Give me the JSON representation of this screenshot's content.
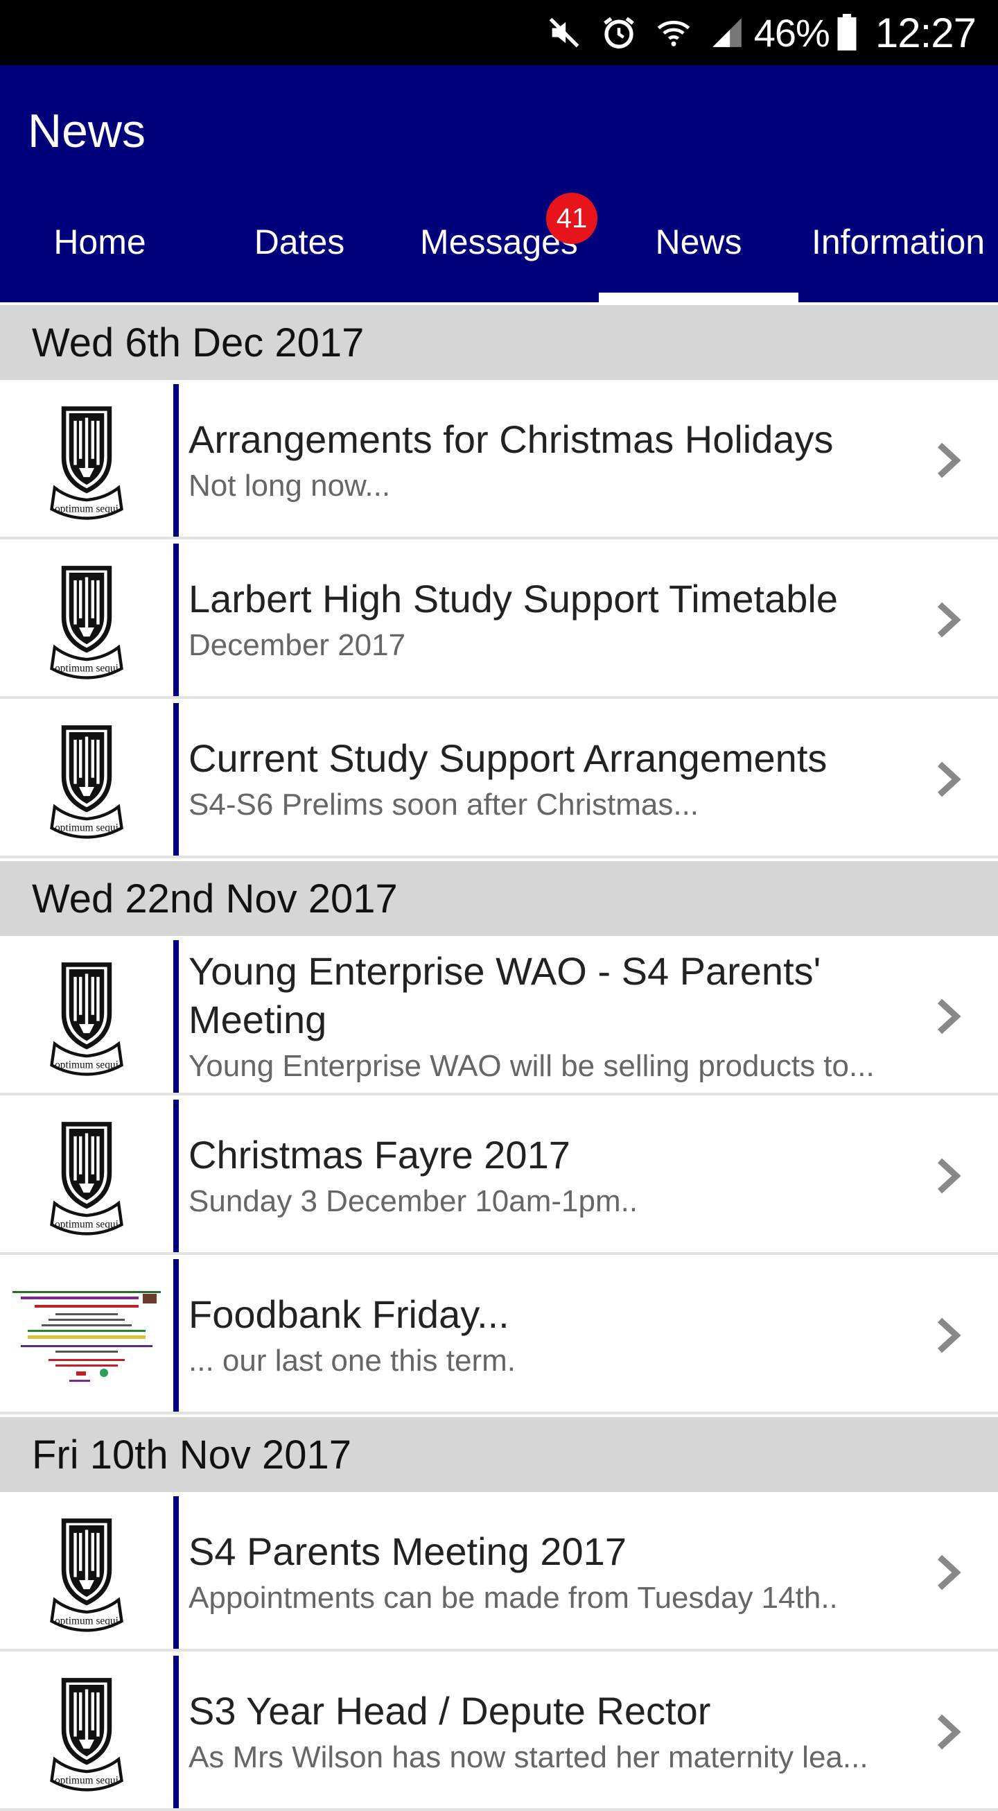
{
  "status_bar": {
    "battery_text": "46%",
    "time": "12:27",
    "icons": [
      "mute-icon",
      "alarm-icon",
      "wifi-icon",
      "signal-icon",
      "battery-icon"
    ]
  },
  "app_bar": {
    "title": "News",
    "tabs": [
      {
        "label": "Home"
      },
      {
        "label": "Dates"
      },
      {
        "label": "Messages"
      },
      {
        "label": "News"
      },
      {
        "label": "Information"
      }
    ],
    "messages_badge": "41",
    "active_tab": "News"
  },
  "sections": [
    {
      "date": "Wed 6th Dec 2017",
      "items": [
        {
          "title": "Arrangements for Christmas Holidays",
          "subtitle": "Not long now..."
        },
        {
          "title": "Larbert High Study Support Timetable",
          "subtitle": "December 2017"
        },
        {
          "title": "Current Study Support Arrangements",
          "subtitle": "S4-S6 Prelims soon after Christmas..."
        }
      ]
    },
    {
      "date": "Wed 22nd Nov 2017",
      "items": [
        {
          "title": "Young Enterprise WAO - S4 Parents' Meeting",
          "subtitle": "Young Enterprise WAO will be selling products to..."
        },
        {
          "title": "Christmas Fayre 2017",
          "subtitle": "Sunday 3 December 10am-1pm.."
        },
        {
          "title": "Foodbank Friday...",
          "subtitle": "... our last one this term."
        }
      ]
    },
    {
      "date": "Fri 10th Nov 2017",
      "items": [
        {
          "title": "S4 Parents Meeting 2017",
          "subtitle": "Appointments can be made from Tuesday 14th.."
        },
        {
          "title": "S3 Year Head / Depute Rector",
          "subtitle": "As Mrs Wilson has now started her maternity lea..."
        }
      ]
    }
  ],
  "crest_motto": "optimum sequi",
  "colors": {
    "brand_navy": "#00007a",
    "badge_red": "#e8141b",
    "section_grey": "#d6d6d6"
  }
}
